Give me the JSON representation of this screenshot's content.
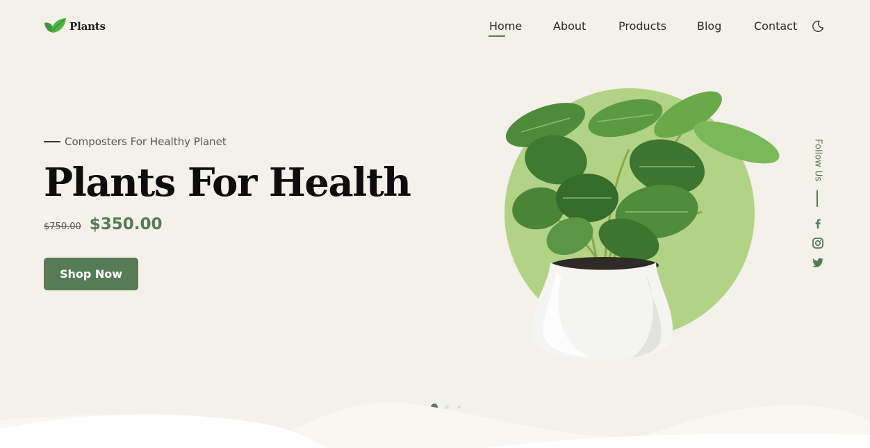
{
  "brand": {
    "name": "Plants",
    "icon": "leaf-icon",
    "colors": {
      "accent": "#567b55",
      "circle": "#b2d385",
      "background": "#f3f1e9"
    }
  },
  "nav": {
    "items": [
      {
        "label": "Home",
        "active": true
      },
      {
        "label": "About",
        "active": false
      },
      {
        "label": "Products",
        "active": false
      },
      {
        "label": "Blog",
        "active": false
      },
      {
        "label": "Contact",
        "active": false
      }
    ],
    "theme_toggle_icon": "moon-icon"
  },
  "hero": {
    "subtitle": "Composters For Healthy Planet",
    "title": "Plants For Health",
    "old_price": "$750.00",
    "price": "$350.00",
    "cta_label": "Shop Now"
  },
  "social": {
    "label": "Follow Us",
    "icons": [
      "facebook-icon",
      "instagram-icon",
      "twitter-icon"
    ]
  },
  "slider": {
    "total": 3,
    "active_index": 0
  }
}
